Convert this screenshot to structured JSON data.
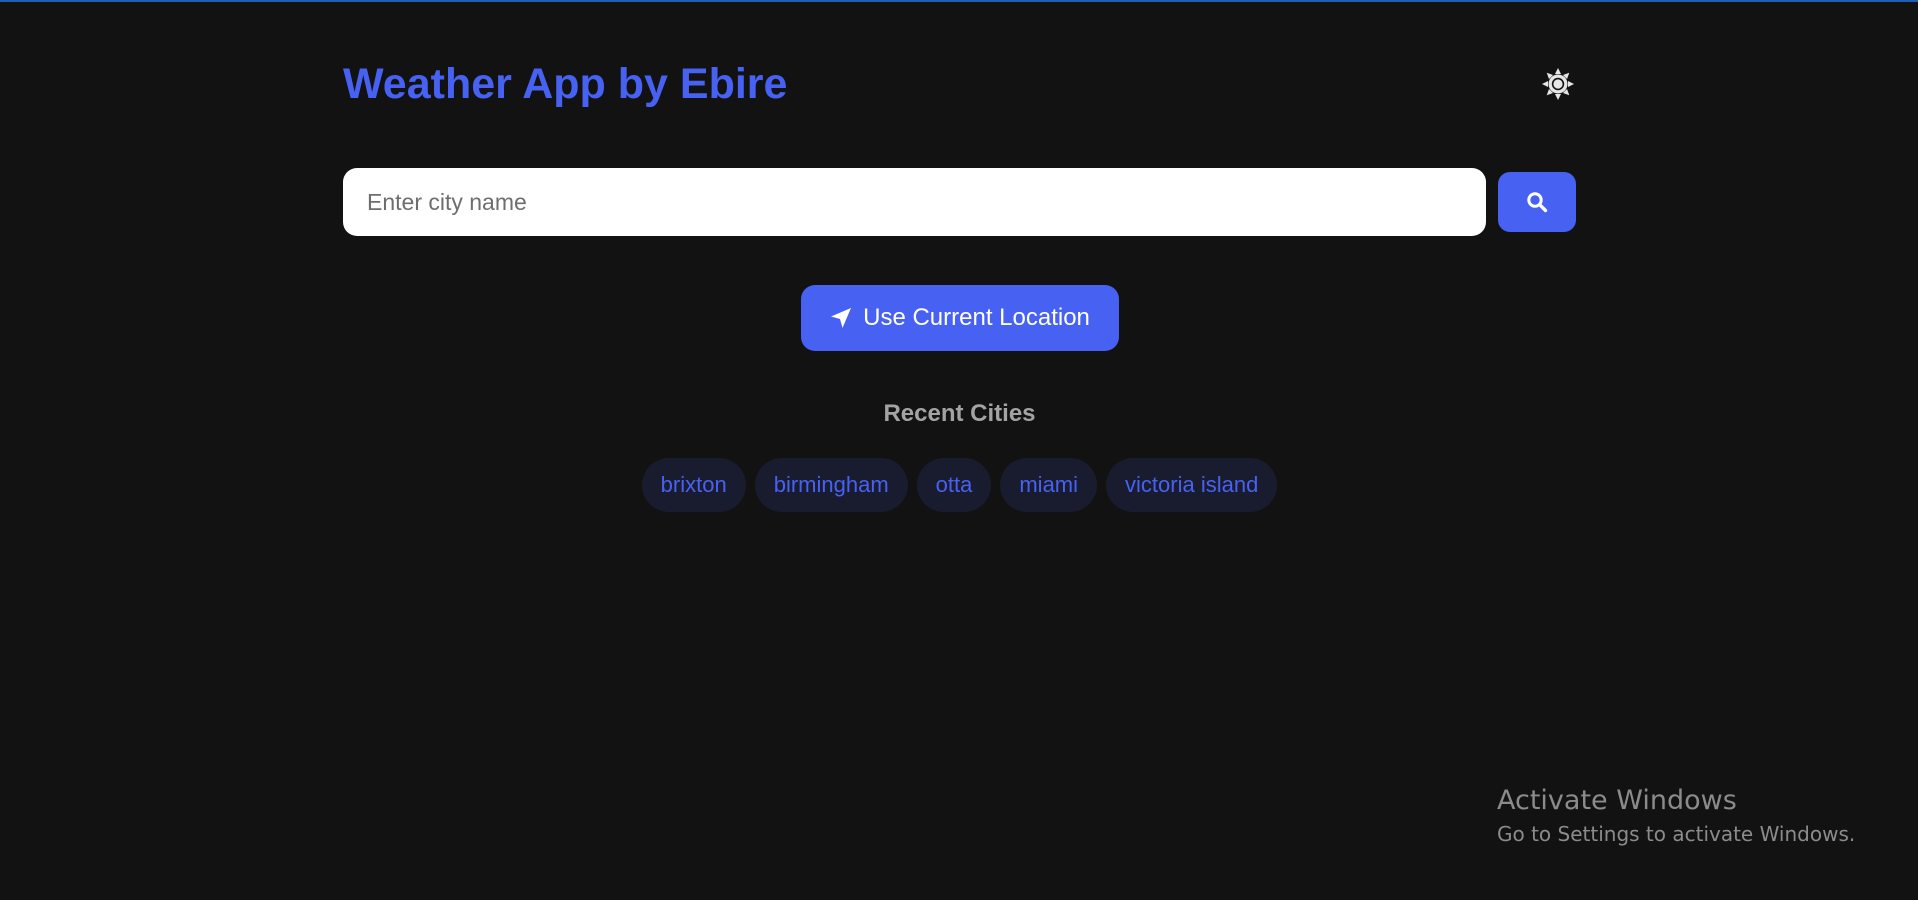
{
  "header": {
    "title": "Weather App by Ebire",
    "theme_toggle_icon": "sun-icon"
  },
  "search": {
    "placeholder": "Enter city name",
    "value": "",
    "button_icon": "search-icon"
  },
  "location": {
    "label": "Use Current Location",
    "icon": "location-arrow-icon"
  },
  "recent": {
    "title": "Recent Cities",
    "cities": [
      "brixton",
      "birmingham",
      "otta",
      "miami",
      "victoria island"
    ]
  },
  "watermark": {
    "title": "Activate Windows",
    "subtitle": "Go to Settings to activate Windows."
  },
  "colors": {
    "background": "#121212",
    "accent": "#4761f2",
    "chip_background": "#181c2e",
    "muted_text": "#a3a3a3"
  }
}
